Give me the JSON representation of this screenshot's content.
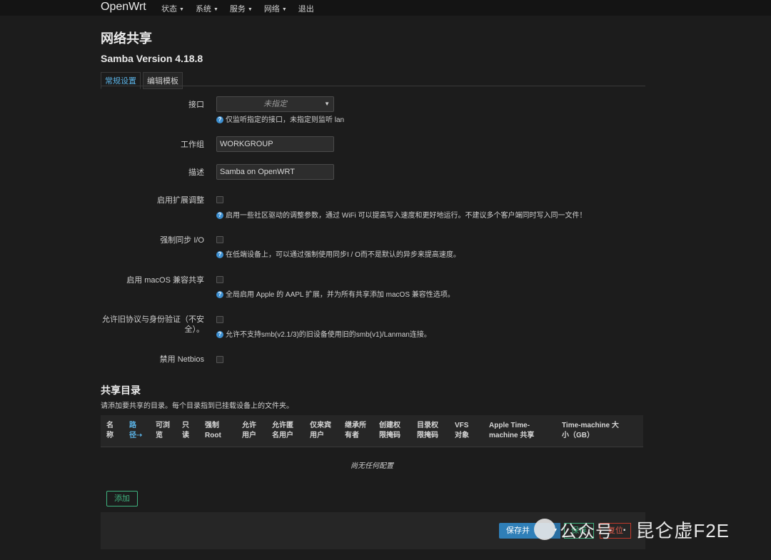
{
  "brand": "OpenWrt",
  "menu": [
    {
      "label": "状态",
      "has_caret": true
    },
    {
      "label": "系统",
      "has_caret": true
    },
    {
      "label": "服务",
      "has_caret": true
    },
    {
      "label": "网络",
      "has_caret": true
    },
    {
      "label": "退出",
      "has_caret": false
    }
  ],
  "page_title": "网络共享",
  "version": "Samba Version 4.18.8",
  "tabs": [
    {
      "label": "常规设置",
      "active": true
    },
    {
      "label": "编辑模板",
      "active": false
    }
  ],
  "form": {
    "interface": {
      "label": "接口",
      "value": "未指定",
      "help": "仅监听指定的接口，未指定则监听 lan"
    },
    "workgroup": {
      "label": "工作组",
      "value": "WORKGROUP"
    },
    "description": {
      "label": "描述",
      "value": "Samba on OpenWRT"
    },
    "ext_tuning": {
      "label": "启用扩展调整",
      "checked": false,
      "help": "启用一些社区驱动的调整参数，通过 WiFi 可以提高写入速度和更好地运行。不建议多个客户端同时写入同一文件！"
    },
    "force_sync": {
      "label": "强制同步 I/O",
      "checked": false,
      "help": "在低端设备上，可以通过强制使用同步I / O而不是默认的异步来提高速度。"
    },
    "macos": {
      "label": "启用 macOS 兼容共享",
      "checked": false,
      "help": "全局启用 Apple 的 AAPL 扩展，并为所有共享添加 macOS 兼容性选项。"
    },
    "legacy_line1": "允许旧协议与身份验证（不安",
    "legacy_line2": "全）。",
    "legacy": {
      "checked": false,
      "help": "允许不支持smb(v2.1/3)的旧设备使用旧的smb(v1)/Lanman连接。"
    },
    "netbios": {
      "label": "禁用 Netbios",
      "checked": false
    }
  },
  "shares": {
    "title": "共享目录",
    "description": "请添加要共享的目录。每个目录指到已挂载设备上的文件夹。",
    "columns": [
      [
        "名",
        "称"
      ],
      [
        "路",
        "径⇢"
      ],
      [
        "可浏",
        "览"
      ],
      [
        "只",
        "读"
      ],
      [
        "强制",
        "Root"
      ],
      [
        "允许",
        "用户"
      ],
      [
        "允许匿",
        "名用户"
      ],
      [
        "仅来宾",
        "用户"
      ],
      [
        "继承所",
        "有者"
      ],
      [
        "创建权",
        "限掩码"
      ],
      [
        "目录权",
        "限掩码"
      ],
      [
        "VFS",
        "对象"
      ],
      [
        "Apple Time-",
        "machine 共享"
      ],
      [
        "Time-machine 大",
        "小（GB）"
      ]
    ],
    "empty": "尚无任何配置",
    "add_label": "添加"
  },
  "footer": {
    "save_label": "保存并",
    "apply_label": "保存",
    "reset_label": "复位"
  },
  "watermark": {
    "text": "公众号",
    "separator": "·",
    "name": "昆仑虚F2E"
  }
}
